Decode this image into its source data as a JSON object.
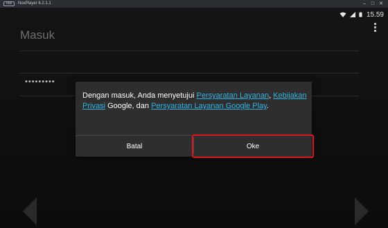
{
  "window": {
    "logo_text": "nox",
    "title": "NoxPlayer 6.2.1.1"
  },
  "statusbar": {
    "time": "15.59"
  },
  "page": {
    "title": "Masuk",
    "password_value": "•••••••••"
  },
  "dialog": {
    "message_prefix": "Dengan masuk, Anda menyetujui ",
    "link_terms": "Persyaratan Layanan",
    "sep1": ", ",
    "link_privacy": "Kebijakan Privasi",
    "mid_text": " Google, dan ",
    "link_play_terms": "Persyaratan Layanan Google Play",
    "suffix": ".",
    "cancel_label": "Batal",
    "ok_label": "Oke"
  },
  "colors": {
    "link": "#33b5e5",
    "highlight": "#e0161d",
    "dialog_bg": "#2e2e2e"
  },
  "icons": [
    "wifi-icon",
    "signal-icon",
    "battery-icon",
    "overflow-menu-icon",
    "nav-back-arrow-icon",
    "nav-next-arrow-icon"
  ]
}
